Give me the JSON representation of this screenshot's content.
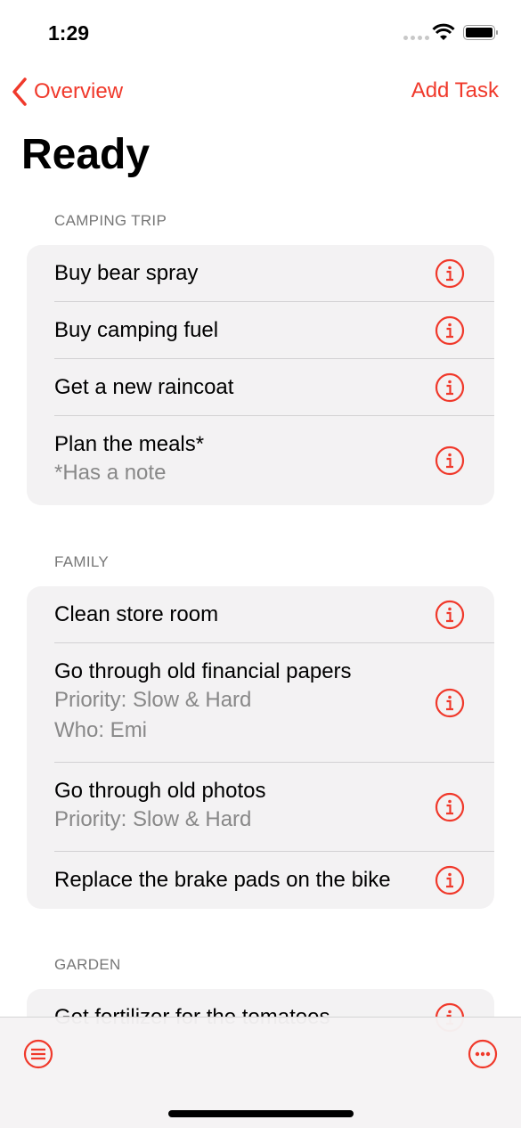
{
  "status": {
    "time": "1:29"
  },
  "nav": {
    "back_label": "Overview",
    "add_label": "Add Task"
  },
  "title": "Ready",
  "accent": "#f0392b",
  "sections": [
    {
      "header": "CAMPING TRIP",
      "items": [
        {
          "title": "Buy bear spray"
        },
        {
          "title": "Buy camping fuel"
        },
        {
          "title": "Get a new raincoat"
        },
        {
          "title": "Plan the meals*",
          "subs": [
            "*Has a note"
          ]
        }
      ]
    },
    {
      "header": "FAMILY",
      "items": [
        {
          "title": "Clean store room"
        },
        {
          "title": "Go through old financial papers",
          "subs": [
            "Priority: Slow & Hard",
            "Who: Emi"
          ]
        },
        {
          "title": "Go through old photos",
          "subs": [
            "Priority: Slow & Hard"
          ]
        },
        {
          "title": "Replace the brake pads on the bike"
        }
      ]
    },
    {
      "header": "GARDEN",
      "items": [
        {
          "title": "Get fertilizer for the tomatoes"
        }
      ]
    }
  ],
  "toolbar": {
    "left_icon": "list-circle-icon",
    "right_icon": "ellipsis-circle-icon"
  }
}
